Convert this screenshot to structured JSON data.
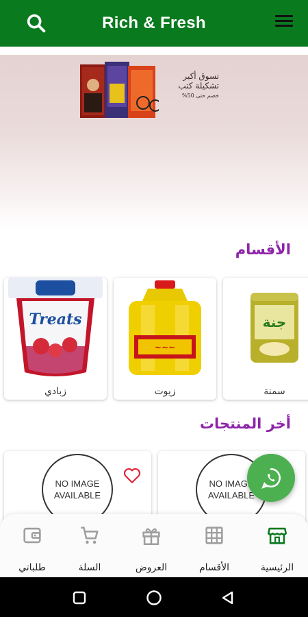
{
  "app_bar": {
    "title": "Rich & Fresh",
    "search_icon": "search-icon",
    "menu_icon": "hamburger-menu-icon",
    "color": "#0a7a1f"
  },
  "banner": {
    "line1": "تسوق أكبر",
    "line2": "تشكيلة كتب",
    "line3": "خصم حتى 50%"
  },
  "categories_section": {
    "title": "الأقسام",
    "items": [
      {
        "label": "زبادي"
      },
      {
        "label": "زيوت"
      },
      {
        "label": "سمنة"
      }
    ]
  },
  "products_section": {
    "title": "أخر المنتجات",
    "placeholder_line1": "NO IMAGE",
    "placeholder_line2": "AVAILABLE",
    "favorite_icon": "heart-outline-icon"
  },
  "fab": {
    "icon": "whatsapp-icon",
    "color": "#4caf50"
  },
  "bottom_nav": {
    "items": [
      {
        "label": "طلباتي",
        "icon": "wallet-icon"
      },
      {
        "label": "السلة",
        "icon": "cart-icon"
      },
      {
        "label": "العروض",
        "icon": "gift-icon"
      },
      {
        "label": "الأقسام",
        "icon": "grid-icon"
      },
      {
        "label": "الرئيسية",
        "icon": "store-icon",
        "active": true
      }
    ],
    "active_color": "#0a7a1f",
    "inactive_color": "#9e9e9e"
  },
  "system_nav": {
    "icons": [
      "recents-icon",
      "home-circle-icon",
      "back-triangle-icon"
    ]
  }
}
